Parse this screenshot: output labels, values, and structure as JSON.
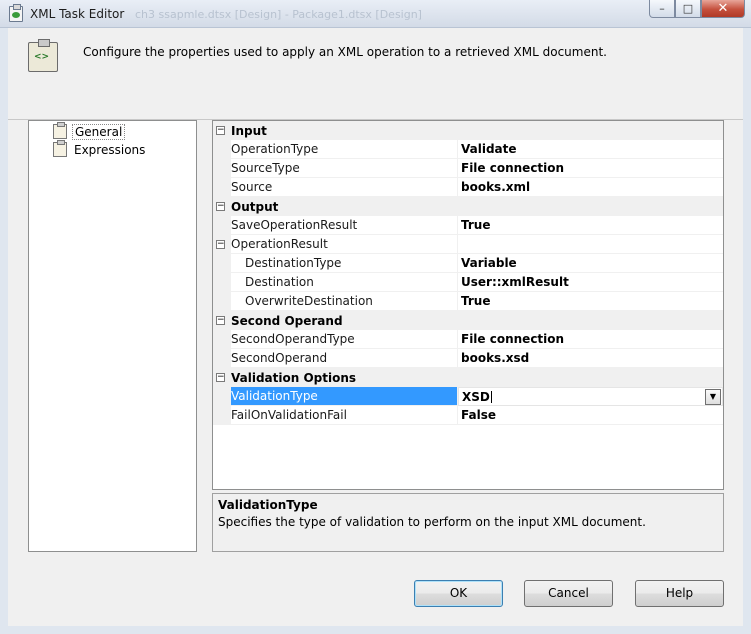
{
  "window": {
    "title": "XML Task Editor",
    "ghost_text": "ch3 ssapmle.dtsx [Design] - Package1.dtsx [Design]",
    "minimize": "–",
    "maximize": "□",
    "close": "✕"
  },
  "header": {
    "description": "Configure the properties used to apply an XML operation to a retrieved XML document."
  },
  "nav": {
    "items": [
      {
        "label": "General"
      },
      {
        "label": "Expressions"
      }
    ]
  },
  "grid": {
    "categories": {
      "input": "Input",
      "output": "Output",
      "second_operand": "Second Operand",
      "validation_options": "Validation Options"
    },
    "rows": {
      "operation_type": {
        "name": "OperationType",
        "value": "Validate"
      },
      "source_type": {
        "name": "SourceType",
        "value": "File connection"
      },
      "source": {
        "name": "Source",
        "value": "books.xml"
      },
      "save_operation_result": {
        "name": "SaveOperationResult",
        "value": "True"
      },
      "operation_result": {
        "name": "OperationResult",
        "value": ""
      },
      "destination_type": {
        "name": "DestinationType",
        "value": "Variable"
      },
      "destination": {
        "name": "Destination",
        "value": "User::xmlResult"
      },
      "overwrite_destination": {
        "name": "OverwriteDestination",
        "value": "True"
      },
      "second_operand_type": {
        "name": "SecondOperandType",
        "value": "File connection"
      },
      "second_operand": {
        "name": "SecondOperand",
        "value": "books.xsd"
      },
      "validation_type": {
        "name": "ValidationType",
        "value": "XSD"
      },
      "fail_on_validation_fail": {
        "name": "FailOnValidationFail",
        "value": "False"
      }
    },
    "expander_symbol": "−"
  },
  "help": {
    "title": "ValidationType",
    "description": "Specifies the type of validation to perform on the input XML document."
  },
  "buttons": {
    "ok": "OK",
    "cancel": "Cancel",
    "help": "Help"
  },
  "colors": {
    "selection": "#3399ff",
    "close_button": "#c5503d"
  }
}
